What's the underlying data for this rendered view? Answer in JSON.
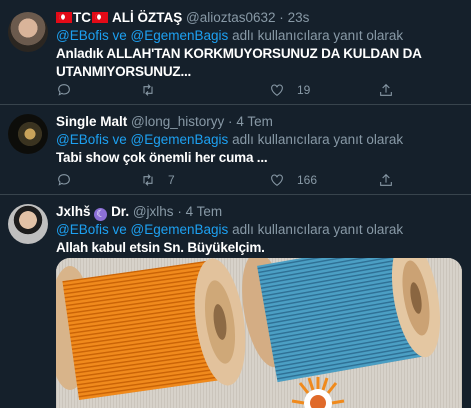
{
  "tweets": [
    {
      "display_name": "ALİ ÖZTAŞ",
      "prefix": "TC",
      "handle": "@alioztas0632",
      "dot": "·",
      "time": "23s",
      "reply_users": [
        "@EBofis",
        "@EgemenBagis"
      ],
      "reply_connector": "ve",
      "reply_suffix": "adlı kullanıcılara yanıt olarak",
      "text_line1": "Anladık ALLAH'TAN KORKMUYORSUNUZ DA KULDAN DA",
      "text_line2": "UTANMIYORSUNUZ...",
      "reply_count": "",
      "retweet_count": "",
      "like_count": "19"
    },
    {
      "display_name": "Single Malt",
      "handle": "@long_historyy",
      "dot": "·",
      "time": "4 Tem",
      "reply_users": [
        "@EBofis",
        "@EgemenBagis"
      ],
      "reply_connector": "ve",
      "reply_suffix": "adlı kullanıcılara yanıt olarak",
      "text_line1": "Tabi show çok önemli her cuma ...",
      "reply_count": "",
      "retweet_count": "7",
      "like_count": "166"
    },
    {
      "display_name_part1": "Jxlhš",
      "display_name_part2": "Dr.",
      "moon": "☾",
      "handle": "@jxlhs",
      "dot": "·",
      "time": "4 Tem",
      "reply_users": [
        "@EBofis",
        "@EgemenBagis"
      ],
      "reply_connector": "ve",
      "reply_suffix": "adlı kullanıcılara yanıt olarak",
      "text_line1": "Allah kabul etsin Sn. Büyükelçim."
    }
  ],
  "icons": [
    "reply-icon",
    "retweet-icon",
    "like-icon",
    "share-icon"
  ],
  "colors": {
    "background": "#15202b",
    "link": "#1da1f2",
    "muted": "#8899a6",
    "divider": "#38444d"
  }
}
